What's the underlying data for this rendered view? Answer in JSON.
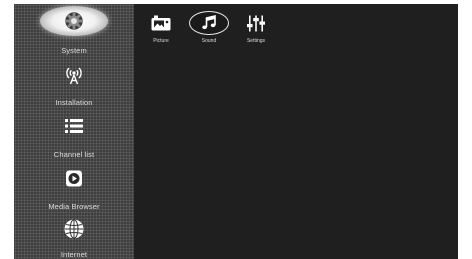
{
  "sidebar": {
    "items": [
      {
        "label": "System",
        "icon": "gear-icon",
        "selected": true
      },
      {
        "label": "Installation",
        "icon": "antenna-icon",
        "selected": false
      },
      {
        "label": "Channel list",
        "icon": "list-icon",
        "selected": false
      },
      {
        "label": "Media Browser",
        "icon": "play-icon",
        "selected": false
      },
      {
        "label": "Internet",
        "icon": "globe-icon",
        "selected": false
      }
    ]
  },
  "submenu": {
    "items": [
      {
        "label": "Picture",
        "icon": "picture-icon",
        "selected": false
      },
      {
        "label": "Sound",
        "icon": "music-note-icon",
        "selected": true
      },
      {
        "label": "Settings",
        "icon": "sliders-icon",
        "selected": false
      }
    ]
  },
  "colors": {
    "background": "#1f1f1f",
    "sidebar": "#4a4a4a",
    "text": "#dcdcdc",
    "highlight": "#ffffff"
  }
}
